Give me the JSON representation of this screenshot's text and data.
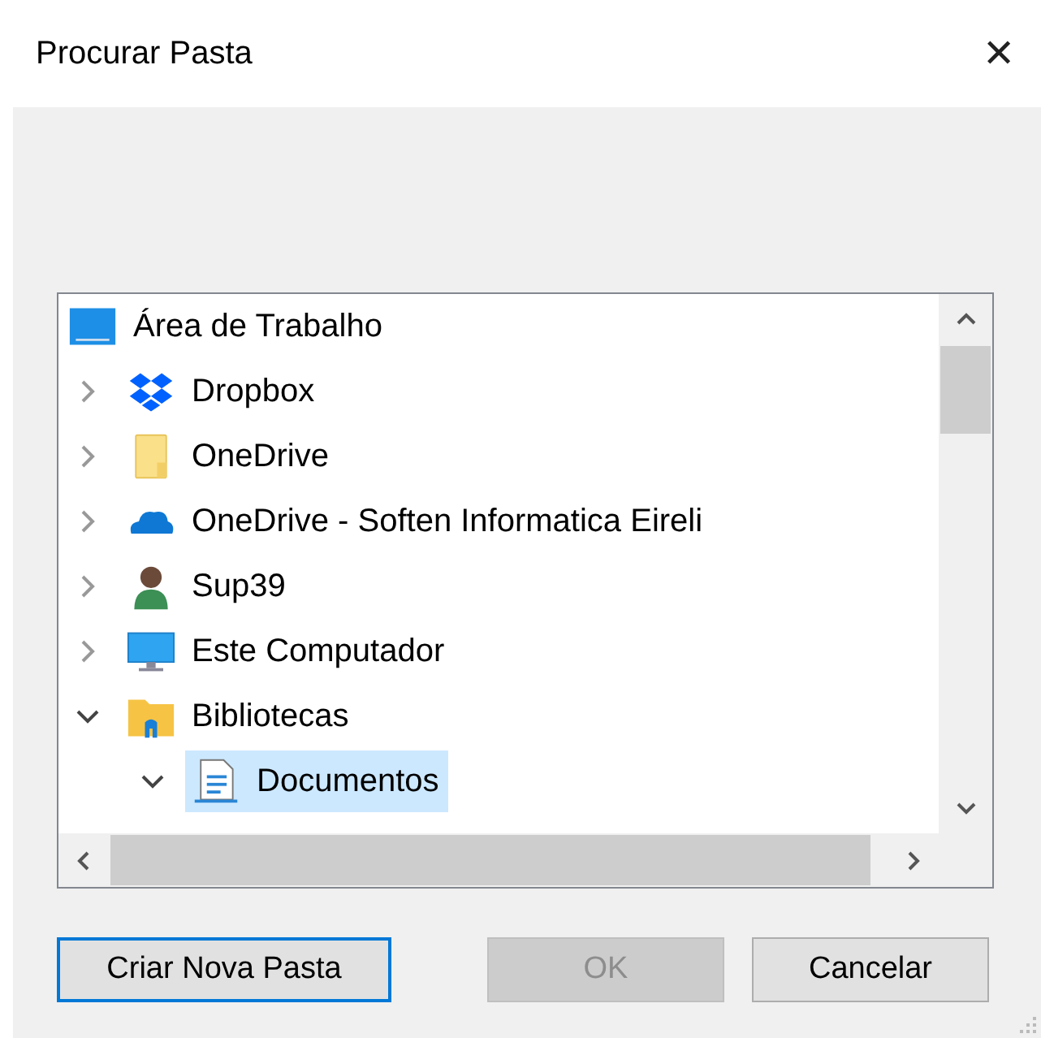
{
  "window": {
    "title": "Procurar Pasta",
    "close": "✕"
  },
  "tree": [
    {
      "label": "Área de Trabalho",
      "kind": "desktop",
      "selected": false,
      "children": [
        {
          "label": "Dropbox",
          "kind": "dropbox",
          "expanded": false,
          "selected": false
        },
        {
          "label": "OneDrive",
          "kind": "folder",
          "expanded": false,
          "selected": false
        },
        {
          "label": "OneDrive - Soften Informatica Eireli",
          "kind": "cloud",
          "expanded": false,
          "selected": false
        },
        {
          "label": "Sup39",
          "kind": "user",
          "expanded": false,
          "selected": false
        },
        {
          "label": "Este Computador",
          "kind": "computer",
          "expanded": false,
          "selected": false
        },
        {
          "label": "Bibliotecas",
          "kind": "library",
          "expanded": true,
          "selected": false,
          "children": [
            {
              "label": "Documentos",
              "kind": "document",
              "expanded": true,
              "selected": true
            }
          ]
        }
      ]
    }
  ],
  "buttons": [
    {
      "label": "Criar Nova Pasta",
      "kind": "default",
      "disabled": false
    },
    {
      "label": "OK",
      "kind": "normal",
      "disabled": true
    },
    {
      "label": "Cancelar",
      "kind": "normal",
      "disabled": false
    }
  ]
}
